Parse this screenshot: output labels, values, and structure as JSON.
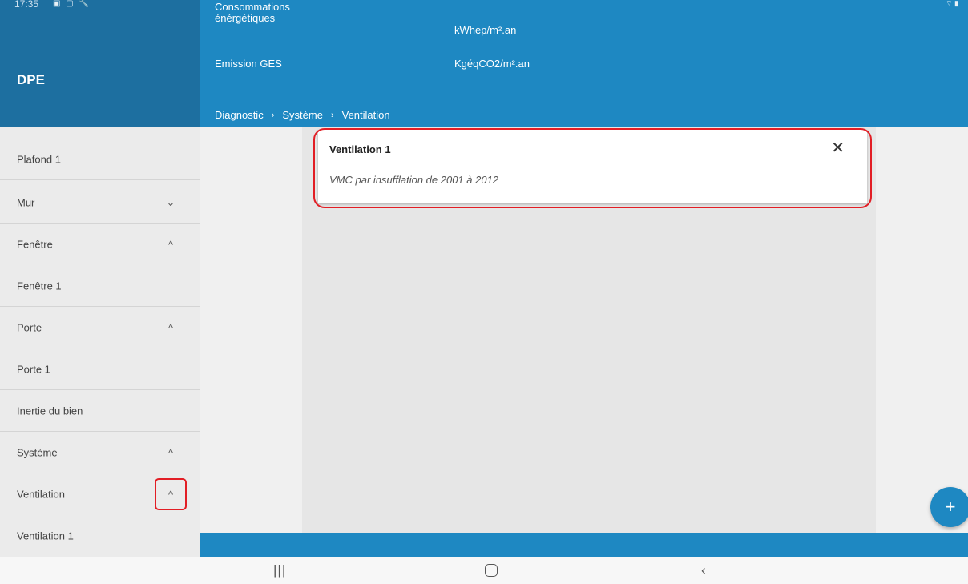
{
  "status_bar": {
    "time": "17:35",
    "icons": "▣ ▢ 🔧",
    "right_icons": "⌔ ▮"
  },
  "app": {
    "title": "DPE"
  },
  "header": {
    "conso_label": "Consommations énérgétiques",
    "conso_unit": "kWhep/m².an",
    "ges_label": "Emission GES",
    "ges_unit": "KgéqCO2/m².an"
  },
  "breadcrumb": [
    "Diagnostic",
    "Système",
    "Ventilation"
  ],
  "breadcrumb_separator": "›",
  "sidebar": {
    "items": [
      {
        "label": "Plafond 1",
        "chevron": ""
      },
      {
        "label": "Mur",
        "chevron": "⌄"
      },
      {
        "label": "Fenêtre",
        "chevron": "^"
      },
      {
        "label": "Fenêtre 1",
        "chevron": ""
      },
      {
        "label": "Porte",
        "chevron": "^"
      },
      {
        "label": "Porte 1",
        "chevron": ""
      },
      {
        "label": "Inertie du bien",
        "chevron": ""
      },
      {
        "label": "Système",
        "chevron": "^"
      },
      {
        "label": "Ventilation",
        "chevron": "^"
      },
      {
        "label": "Ventilation 1",
        "chevron": ""
      }
    ]
  },
  "card": {
    "title": "Ventilation 1",
    "subtitle": "VMC par insufflation de 2001 à 2012",
    "close_icon": "✕"
  },
  "fab": {
    "icon": "+"
  },
  "navbar": {
    "recent": "|||",
    "home": "",
    "back": "‹"
  },
  "colors": {
    "header_dark": "#1d6fa0",
    "header": "#1e88c2",
    "highlight": "#e21e25"
  }
}
